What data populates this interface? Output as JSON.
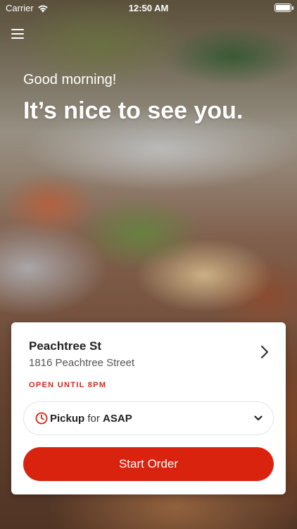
{
  "status_bar": {
    "carrier": "Carrier",
    "time": "12:50 AM"
  },
  "header": {
    "greeting": "Good morning!",
    "headline": "It’s nice to see you."
  },
  "store": {
    "name": "Peachtree St",
    "address": "1816 Peachtree Street",
    "open_status": "OPEN UNTIL 8PM"
  },
  "order": {
    "type": "Pickup",
    "connector": "for",
    "time": "ASAP"
  },
  "start_button": {
    "label": "Start Order"
  },
  "colors": {
    "accent": "#d9230f",
    "open_status": "#d42a1b"
  },
  "icons": [
    "wifi-icon",
    "battery-icon",
    "menu-icon",
    "chevron-right-icon",
    "clock-icon",
    "chevron-down-icon"
  ]
}
